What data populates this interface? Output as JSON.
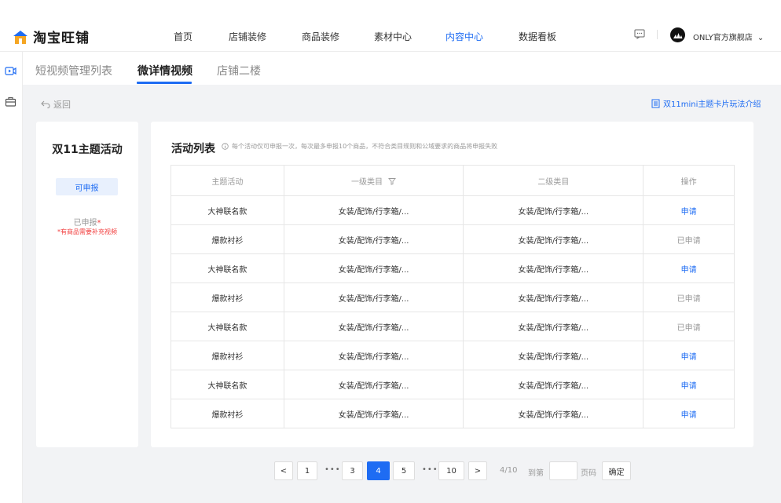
{
  "brand": {
    "name": "淘宝旺铺"
  },
  "nav": {
    "items": [
      "首页",
      "店铺装修",
      "商品装修",
      "素材中心",
      "内容中心",
      "数据看板"
    ],
    "active_index": 4
  },
  "account": {
    "shop_name": "ONLY官方旗舰店"
  },
  "tabs": {
    "items": [
      "短视频管理列表",
      "微详情视频",
      "店铺二楼"
    ],
    "active_index": 1
  },
  "back_label": "返回",
  "guide_link": "双11mini主题卡片玩法介绍",
  "left_panel": {
    "title": "双11主题活动",
    "apply_button": "可申报",
    "applied_label": "已申报",
    "required_mark": "*",
    "note": "*有商品需要补充视频"
  },
  "activity": {
    "title": "活动列表",
    "hint": "每个活动仅可申报一次，每次最多申报10个商品，不符合类目规则和公域要求的商品将申报失败",
    "columns": [
      "主题活动",
      "一级类目",
      "二级类目",
      "操作"
    ],
    "rows": [
      {
        "theme": "大神联名款",
        "cat1": "女装/配饰/行李箱/...",
        "cat2": "女装/配饰/行李箱/...",
        "action": "申请"
      },
      {
        "theme": "爆款衬衫",
        "cat1": "女装/配饰/行李箱/...",
        "cat2": "女装/配饰/行李箱/...",
        "action": "已申请"
      },
      {
        "theme": "大神联名款",
        "cat1": "女装/配饰/行李箱/...",
        "cat2": "女装/配饰/行李箱/...",
        "action": "申请"
      },
      {
        "theme": "爆款衬衫",
        "cat1": "女装/配饰/行李箱/...",
        "cat2": "女装/配饰/行李箱/...",
        "action": "已申请"
      },
      {
        "theme": "大神联名款",
        "cat1": "女装/配饰/行李箱/...",
        "cat2": "女装/配饰/行李箱/...",
        "action": "已申请"
      },
      {
        "theme": "爆款衬衫",
        "cat1": "女装/配饰/行李箱/...",
        "cat2": "女装/配饰/行李箱/...",
        "action": "申请"
      },
      {
        "theme": "大神联名款",
        "cat1": "女装/配饰/行李箱/...",
        "cat2": "女装/配饰/行李箱/...",
        "action": "申请"
      },
      {
        "theme": "爆款衬衫",
        "cat1": "女装/配饰/行李箱/...",
        "cat2": "女装/配饰/行李箱/...",
        "action": "申请"
      }
    ]
  },
  "pagination": {
    "prev": "<",
    "next": ">",
    "pages": [
      "1",
      "3",
      "4",
      "5",
      "10"
    ],
    "current": "4",
    "ellipsis": "•••",
    "current_page_text": "4",
    "total_pages_text": "/10",
    "goto_label": "到第",
    "page_unit": "页码",
    "confirm": "确定"
  },
  "colors": {
    "accent": "#1e6cf3",
    "warning": "#f23d3d",
    "background": "#f2f3f5"
  }
}
